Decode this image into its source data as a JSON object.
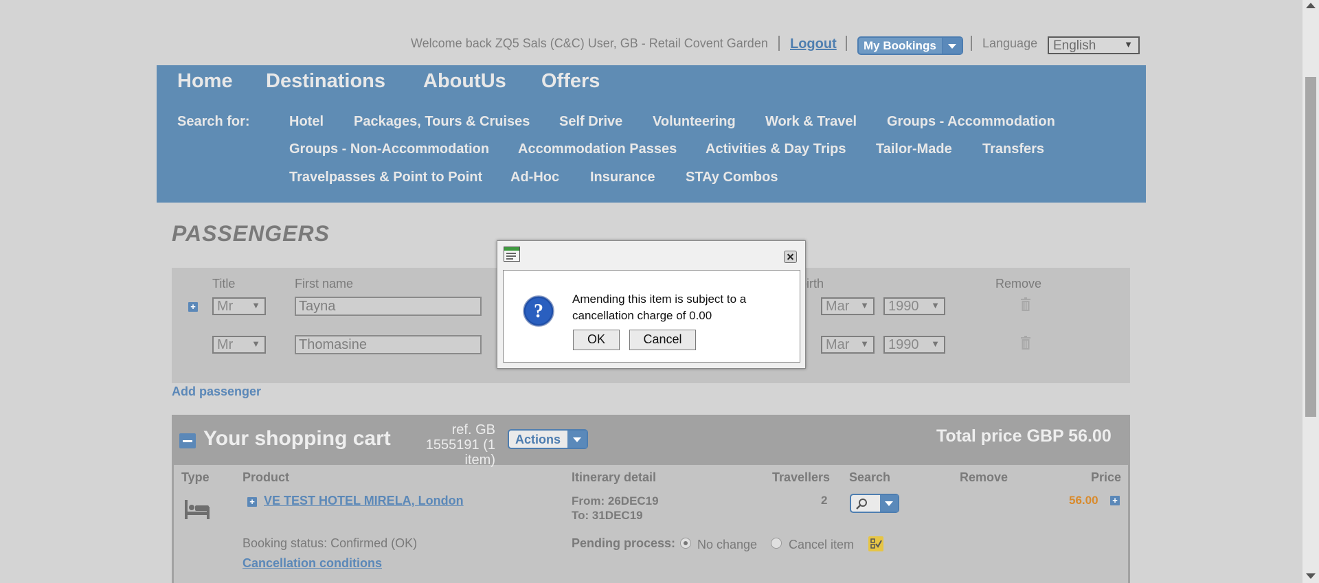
{
  "header": {
    "welcome": "Welcome back ZQ5 Sals (C&C) User, GB - Retail Covent Garden",
    "logout": "Logout",
    "my_bookings": "My Bookings",
    "language_label": "Language",
    "language_value": "English"
  },
  "nav": {
    "main": [
      "Home",
      "Destinations",
      "AboutUs",
      "Offers"
    ],
    "search_for_label": "Search for:",
    "row1": [
      "Hotel",
      "Packages, Tours & Cruises",
      "Self Drive",
      "Volunteering",
      "Work & Travel",
      "Groups - Accommodation"
    ],
    "row2": [
      "Groups - Non-Accommodation",
      "Accommodation Passes",
      "Activities & Day Trips",
      "Tailor-Made",
      "Transfers"
    ],
    "row3": [
      "Travelpasses & Point to Point",
      "Ad-Hoc",
      "Insurance",
      "STAy Combos"
    ]
  },
  "passengers": {
    "title": "PASSENGERS",
    "headers": {
      "title": "Title",
      "first_name": "First name",
      "dob_partial": "birth",
      "remove": "Remove"
    },
    "rows": [
      {
        "title": "Mr",
        "first_name": "Tayna",
        "month": "Mar",
        "year": "1990"
      },
      {
        "title": "Mr",
        "first_name": "Thomasine",
        "month": "Mar",
        "year": "1990"
      }
    ],
    "add_passenger": "Add passenger"
  },
  "cart": {
    "title": "Your shopping cart",
    "ref_line1": "ref. GB",
    "ref_line2": "1555191 (1 item)",
    "actions": "Actions",
    "total": "Total price GBP 56.00",
    "headers": {
      "type": "Type",
      "product": "Product",
      "itinerary": "Itinerary detail",
      "travellers": "Travellers",
      "search": "Search",
      "remove": "Remove",
      "price": "Price"
    },
    "item": {
      "product": "VE TEST HOTEL MIRELA, London",
      "from": "From: 26DEC19",
      "to": "To: 31DEC19",
      "travellers": "2",
      "price": "56.00",
      "booking_status": "Booking status: Confirmed (OK)",
      "cancellation_link": "Cancellation conditions",
      "pending_label": "Pending process:",
      "opt_no_change": "No change",
      "opt_cancel": "Cancel item"
    }
  },
  "dialog": {
    "message": "Amending this item is subject to a cancellation charge of 0.00",
    "ok": "OK",
    "cancel": "Cancel"
  },
  "colors": {
    "nav_bg": "#5f8cb4",
    "accent": "#5b88b8",
    "price": "#d98a2b"
  }
}
